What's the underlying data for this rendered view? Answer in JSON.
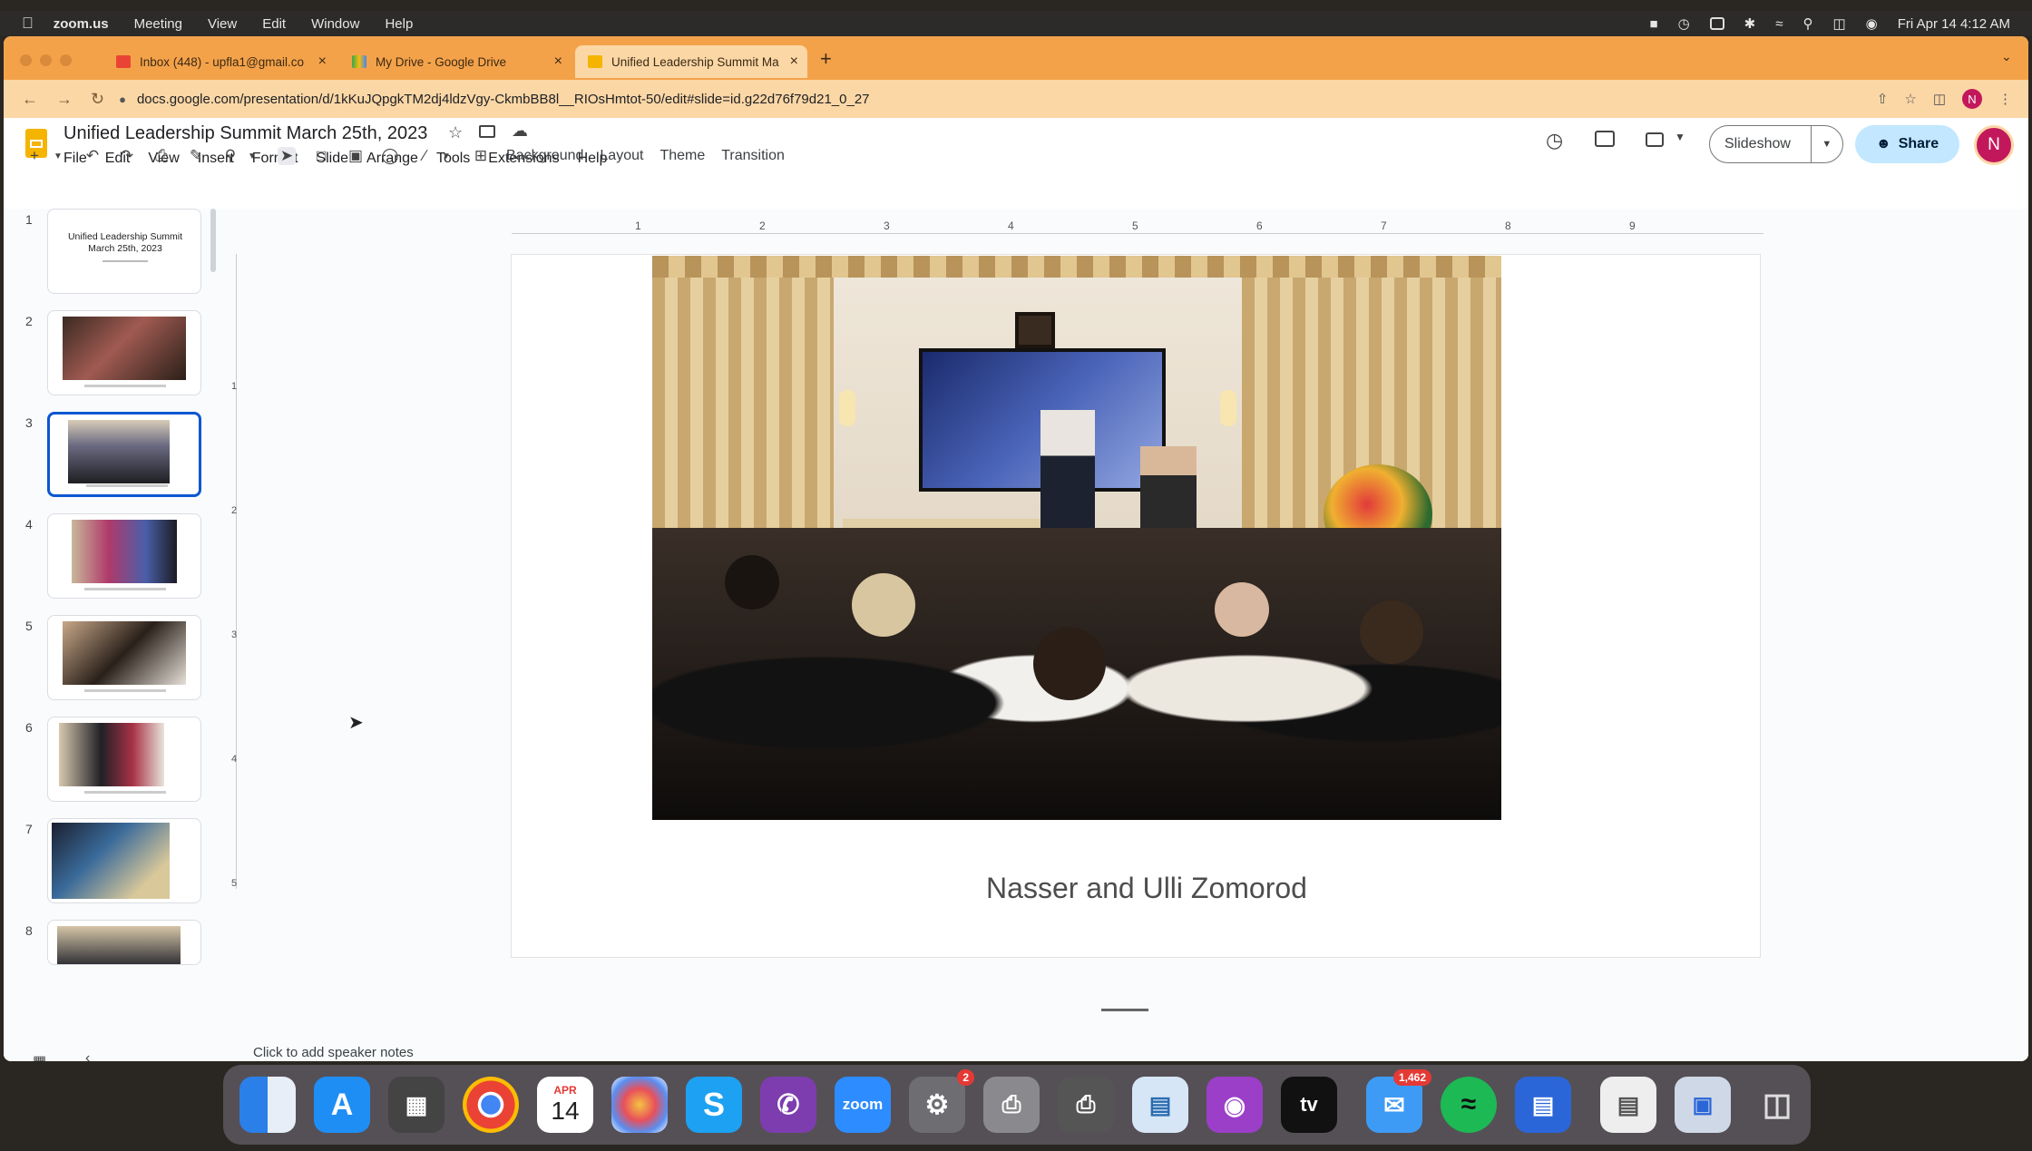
{
  "menubar": {
    "app": "zoom.us",
    "items": [
      "Meeting",
      "View",
      "Edit",
      "Window",
      "Help"
    ],
    "datetime": "Fri Apr 14  4:12 AM"
  },
  "browser": {
    "tabs": [
      {
        "title": "Inbox (448) - upfla1@gmail.co"
      },
      {
        "title": "My Drive - Google Drive"
      },
      {
        "title": "Unified Leadership Summit Ma"
      }
    ],
    "url": "docs.google.com/presentation/d/1kKuJQpgkTM2dj4ldzVgy-CkmbBB8l__RIOsHmtot-50/edit#slide=id.g22d76f79d21_0_27",
    "profile_initial": "N"
  },
  "doc": {
    "title": "Unified Leadership Summit  March 25th, 2023",
    "menus": [
      "File",
      "Edit",
      "View",
      "Insert",
      "Format",
      "Slide",
      "Arrange",
      "Tools",
      "Extensions",
      "Help"
    ],
    "toolbar_text": {
      "background": "Background",
      "layout": "Layout",
      "theme": "Theme",
      "transition": "Transition"
    },
    "slideshow_label": "Slideshow",
    "share_label": "Share",
    "avatar_initial": "N"
  },
  "ruler": {
    "top_ticks": [
      "1",
      "2",
      "3",
      "4",
      "5",
      "6",
      "7",
      "8",
      "9"
    ],
    "left_ticks": [
      "1",
      "2",
      "3",
      "4",
      "5"
    ]
  },
  "filmstrip": {
    "numbers": [
      "1",
      "2",
      "3",
      "4",
      "5",
      "6",
      "7",
      "8"
    ],
    "slide1_title": "Unified Leadership Summit March 25th, 2023",
    "selected": "3"
  },
  "slide": {
    "caption": "Nasser and Ulli Zomorod"
  },
  "notes": {
    "placeholder": "Click to add speaker notes"
  },
  "dock": {
    "calendar_month": "APR",
    "calendar_day": "14",
    "zoom_label": "zoom",
    "settings_badge": "2",
    "mail_badge": "1,462",
    "appletv_label": "tv"
  }
}
